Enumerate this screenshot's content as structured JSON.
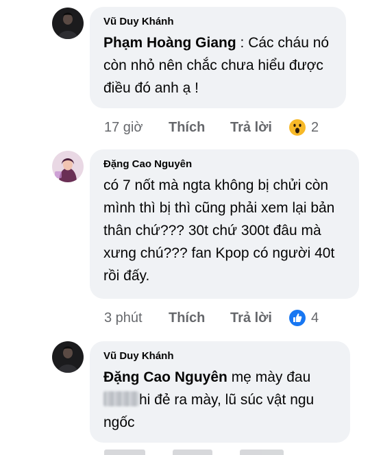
{
  "comments": [
    {
      "author": "Vũ Duy Khánh",
      "mention": "Phạm Hoàng Giang",
      "text_before_blur": " : Các cháu nó còn nhỏ nên chắc chưa hiểu được điều đó anh ạ !",
      "time": "17 giờ",
      "like_label": "Thích",
      "reply_label": "Trả lời",
      "reaction": "wow-icon",
      "reaction_count": "2"
    },
    {
      "author": "Đặng Cao Nguyên",
      "text": "có 7 nốt mà ngta không bị chửi còn mình thì bị thì cũng phải xem lại bản thân chứ??? 30t chứ 300t đâu mà xưng chú??? fan Kpop có người 40t rồi đấy.",
      "time": "3 phút",
      "like_label": "Thích",
      "reply_label": "Trả lời",
      "reaction": "like-icon",
      "reaction_count": "4"
    },
    {
      "author": "Vũ Duy Khánh",
      "mention": "Đặng Cao Nguyên",
      "text_before_blur": " mẹ mày đau ",
      "text_after_blur": "hi đẻ ra mày, lũ súc vật ngu ngốc"
    }
  ],
  "colors": {
    "bubble": "#f0f2f5",
    "meta": "#65676b",
    "like_blue": "#1877f2",
    "wow_yellow": "#f7b928"
  }
}
